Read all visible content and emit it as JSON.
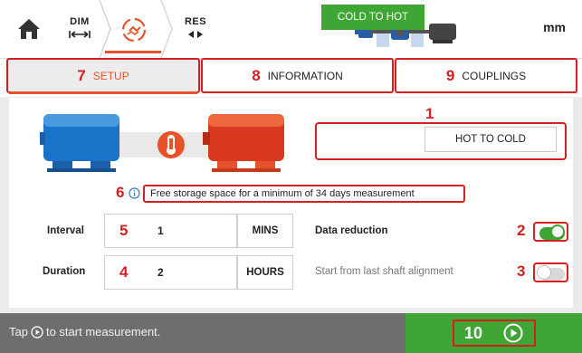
{
  "nav": {
    "dim_label": "DIM",
    "res_label": "RES",
    "unit": "mm"
  },
  "tabs": [
    {
      "number": "7",
      "label": "SETUP"
    },
    {
      "number": "8",
      "label": "INFORMATION"
    },
    {
      "number": "9",
      "label": "COUPLINGS"
    }
  ],
  "mode": {
    "number": "1",
    "options": [
      "COLD TO HOT",
      "HOT TO COLD"
    ],
    "selected": "COLD TO HOT"
  },
  "storage_info": {
    "number": "6",
    "text": "Free storage space for a minimum of 34 days measurement"
  },
  "interval": {
    "label": "Interval",
    "number": "5",
    "value": "1",
    "unit": "MINS"
  },
  "duration": {
    "label": "Duration",
    "number": "4",
    "value": "2",
    "unit": "HOURS"
  },
  "data_reduction": {
    "label": "Data reduction",
    "number": "2",
    "on": true
  },
  "start_from_last": {
    "label": "Start from last shaft alignment",
    "number": "3",
    "on": false
  },
  "footer": {
    "hint_before": "Tap",
    "hint_after": "to start measurement.",
    "start_number": "10"
  },
  "colors": {
    "accent_orange": "#e8522a",
    "annotation_red": "#d42020",
    "active_green": "#3fa535",
    "cold_blue": "#1b73c9",
    "hot_red": "#d9391f"
  }
}
